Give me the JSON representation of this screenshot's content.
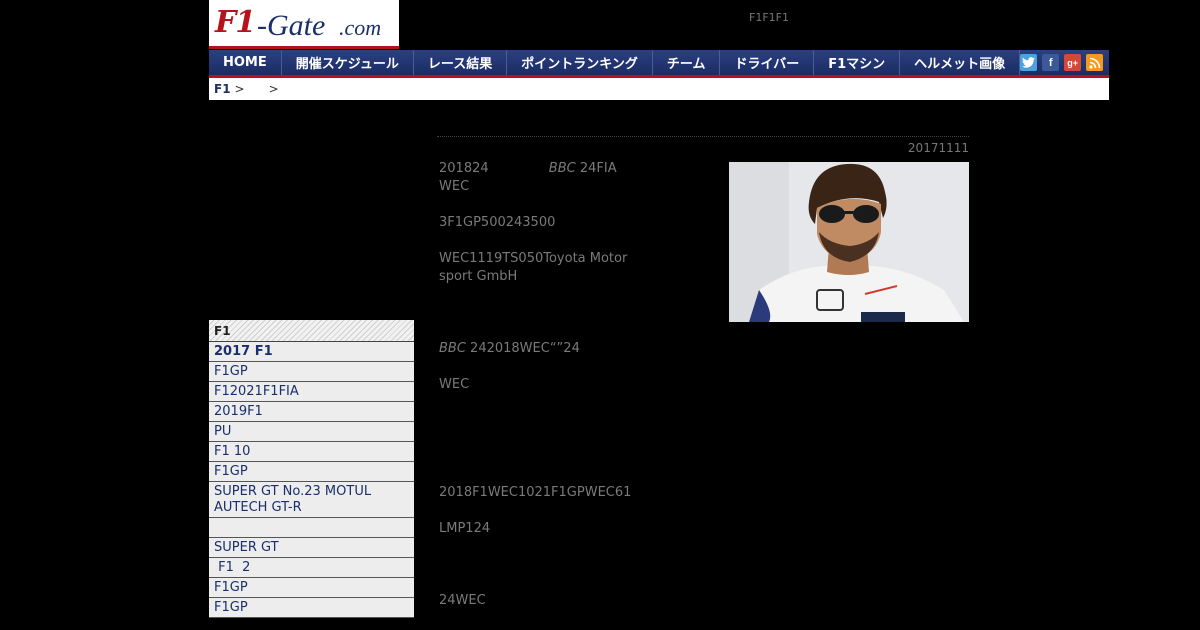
{
  "logo": {
    "f1": "F1",
    "gate": "-Gate",
    "dotcom": ".com"
  },
  "header": {
    "tagline": "F1F1F1"
  },
  "nav": {
    "items": [
      "HOME",
      "開催スケジュール",
      "レース結果",
      "ポイントランキング",
      "チーム",
      "ドライバー",
      "F1マシン",
      "ヘルメット画像"
    ],
    "social": {
      "twitter": "t",
      "facebook": "f",
      "googleplus": "g+",
      "rss": "rss"
    }
  },
  "breadcrumb": {
    "home": "F1",
    "sep1": ">",
    "sep2": ">"
  },
  "sidebar": {
    "heading": "F1",
    "items": [
      "2017 F1",
      "F1GP",
      "F12021F1FIA",
      "2019F1",
      "PU",
      "F1  10",
      "F1GP",
      "SUPER GT No.23 MOTUL AUTECH GT-R",
      "",
      "SUPER GT",
      " F1  2",
      "F1GP",
      "F1GP"
    ]
  },
  "article": {
    "date": "20171111",
    "p1a": "201824",
    "p1b": "BBC",
    "p1c": " 24FIA WEC",
    "p2": "3F1GP500243500",
    "p3": "WEC1119TS050Toyota Motorsport GmbH",
    "p4a": "BBC",
    "p4b": " 242018WEC“”24",
    "p5": "WEC",
    "p6": "2018F1WEC1021F1GPWEC61",
    "p7": "LMP124",
    "p8": "24WEC"
  }
}
